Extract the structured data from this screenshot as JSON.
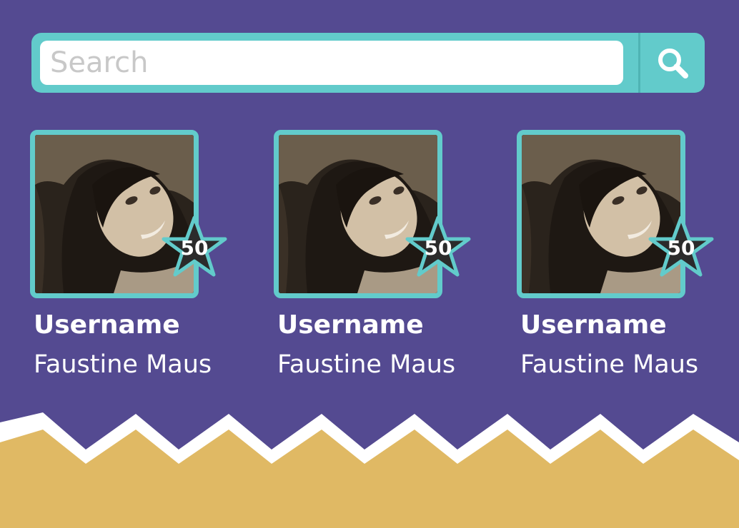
{
  "colors": {
    "background": "#544a91",
    "accent": "#62cbcb",
    "footer": "#e0b964",
    "star": "#2b2b2b"
  },
  "search": {
    "placeholder": "Search",
    "value": "",
    "button_icon": "search-icon"
  },
  "cards": [
    {
      "username_label": "Username",
      "name": "Faustine Maus",
      "score": "50"
    },
    {
      "username_label": "Username",
      "name": "Faustine Maus",
      "score": "50"
    },
    {
      "username_label": "Username",
      "name": "Faustine Maus",
      "score": "50"
    }
  ]
}
